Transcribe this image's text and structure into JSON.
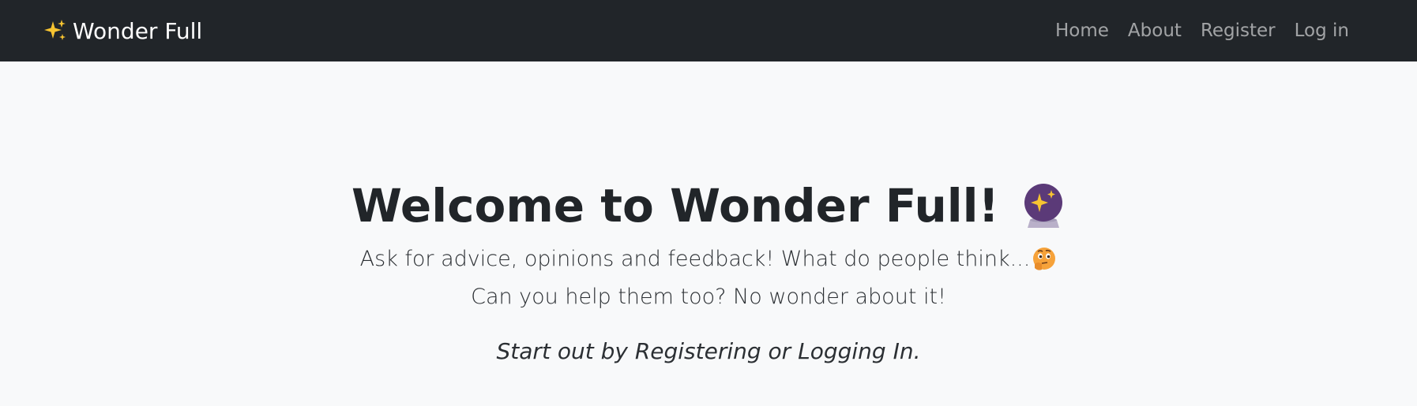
{
  "navbar": {
    "brand_label": "Wonder Full",
    "brand_icon": "sparkles-icon",
    "links": [
      {
        "label": "Home"
      },
      {
        "label": "About"
      },
      {
        "label": "Register"
      },
      {
        "label": "Log in"
      }
    ]
  },
  "hero": {
    "title": "Welcome to Wonder Full!",
    "title_icon": "crystal-ball-icon",
    "lead_line1": "Ask for advice, opinions and feedback! What do people think...",
    "lead_line1_icon": "thinking-face-icon",
    "lead_line2": "Can you help them too? No wonder about it!",
    "cta": "Start out by Registering or Logging In."
  },
  "colors": {
    "navbar_bg": "#212529",
    "page_bg": "#f8f9fa",
    "text": "#212529",
    "nav_link": "#9a9c9f"
  }
}
